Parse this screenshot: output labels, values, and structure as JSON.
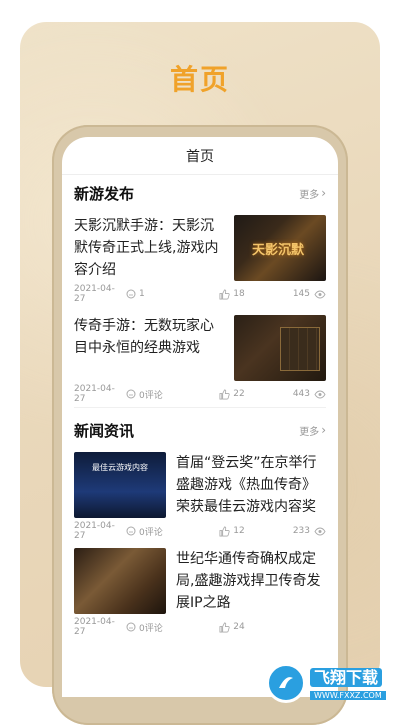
{
  "hero_title": "首页",
  "app": {
    "header_title": "首页"
  },
  "sections": [
    {
      "title": "新游发布",
      "more": "更多",
      "items": [
        {
          "title": "天影沉默手游：天影沉默传奇正式上线,游戏内容介绍",
          "date": "2021-04-27",
          "comments": "1",
          "likes": "18",
          "views": "145",
          "thumb_text": "天影沉默"
        },
        {
          "title": "传奇手游：无数玩家心目中永恒的经典游戏",
          "date": "2021-04-27",
          "comments": "0评论",
          "likes": "22",
          "views": "443"
        }
      ]
    },
    {
      "title": "新闻资讯",
      "more": "更多",
      "items": [
        {
          "title": "首届“登云奖”在京举行盛趣游戏《热血传奇》荣获最佳云游戏内容奖",
          "date": "2021-04-27",
          "comments": "0评论",
          "likes": "12",
          "views": "233",
          "thumb_text": "最佳云游戏内容"
        },
        {
          "title": "世纪华通传奇确权成定局,盛趣游戏捍卫传奇发展IP之路",
          "date": "2021-04-27",
          "comments": "0评论",
          "likes": "24",
          "views": ""
        }
      ]
    }
  ],
  "watermark": {
    "text": "飞翔下载",
    "sub": "WWW.FXXZ.COM"
  },
  "colors": {
    "accent": "#f0a22a",
    "card_bg": "#ecdcc0",
    "watermark": "#2a9fe0"
  }
}
